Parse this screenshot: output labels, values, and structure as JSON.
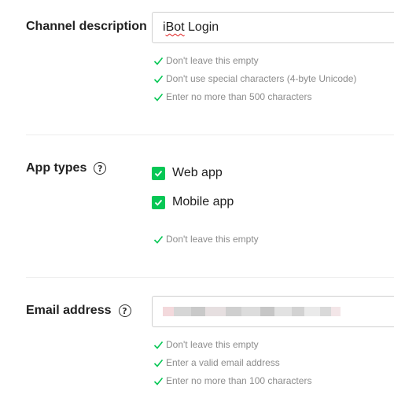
{
  "channel_description": {
    "label": "Channel description",
    "value_prefix": "i",
    "value_underlined": "Bot",
    "value_suffix": " Login",
    "hints": [
      "Don't leave this empty",
      "Don't use special characters (4-byte Unicode)",
      "Enter no more than 500 characters"
    ]
  },
  "app_types": {
    "label": "App types",
    "help_icon": "?",
    "options": [
      {
        "label": "Web app",
        "checked": true
      },
      {
        "label": "Mobile app",
        "checked": true
      }
    ],
    "hints": [
      "Don't leave this empty"
    ]
  },
  "email": {
    "label": "Email address",
    "help_icon": "?",
    "hints": [
      "Don't leave this empty",
      "Enter a valid email address",
      "Enter no more than 100 characters"
    ]
  },
  "colors": {
    "valid_green": "#06c755",
    "hint_gray": "#8c8c8c",
    "border": "#cfcfcf"
  }
}
